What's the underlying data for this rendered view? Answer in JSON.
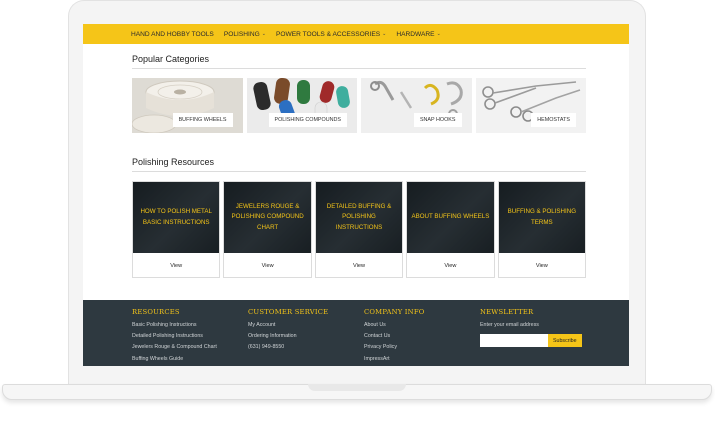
{
  "nav": [
    {
      "label": "HAND AND HOBBY TOOLS"
    },
    {
      "label": "POLISHING"
    },
    {
      "label": "POWER TOOLS & ACCESSORIES"
    },
    {
      "label": "HARDWARE"
    }
  ],
  "popular": {
    "title": "Popular Categories",
    "items": [
      {
        "label": "BUFFING WHEELS"
      },
      {
        "label": "POLISHING COMPOUNDS"
      },
      {
        "label": "SNAP HOOKS"
      },
      {
        "label": "HEMOSTATS"
      }
    ]
  },
  "resources": {
    "title": "Polishing Resources",
    "items": [
      {
        "title": "HOW TO POLISH METAL BASIC INSTRUCTIONS",
        "action": "View"
      },
      {
        "title": "JEWELERS ROUGE & POLISHING COMPOUND CHART",
        "action": "View"
      },
      {
        "title": "DETAILED BUFFING & POLISHING INSTRUCTIONS",
        "action": "View"
      },
      {
        "title": "ABOUT BUFFING WHEELS",
        "action": "View"
      },
      {
        "title": "BUFFING & POLISHING TERMS",
        "action": "View"
      }
    ]
  },
  "footer": {
    "resources": {
      "heading": "RESOURCES",
      "links": [
        "Basic Polishing Instructions",
        "Detailed Polishing Instructions",
        "Jewelers Rouge & Compound Chart",
        "Buffing Wheels Guide"
      ]
    },
    "customer_service": {
      "heading": "CUSTOMER SERVICE",
      "links": [
        "My Account",
        "Ordering Information",
        "(631) 949-8550"
      ]
    },
    "company_info": {
      "heading": "COMPANY INFO",
      "links": [
        "About Us",
        "Contact Us",
        "Privacy Policy",
        "ImpressArt"
      ]
    },
    "newsletter": {
      "heading": "NEWSLETTER",
      "label": "Enter your email address",
      "button": "Subscribe"
    }
  },
  "colors": {
    "accent": "#f5c518",
    "footer_bg": "#2e3940"
  }
}
